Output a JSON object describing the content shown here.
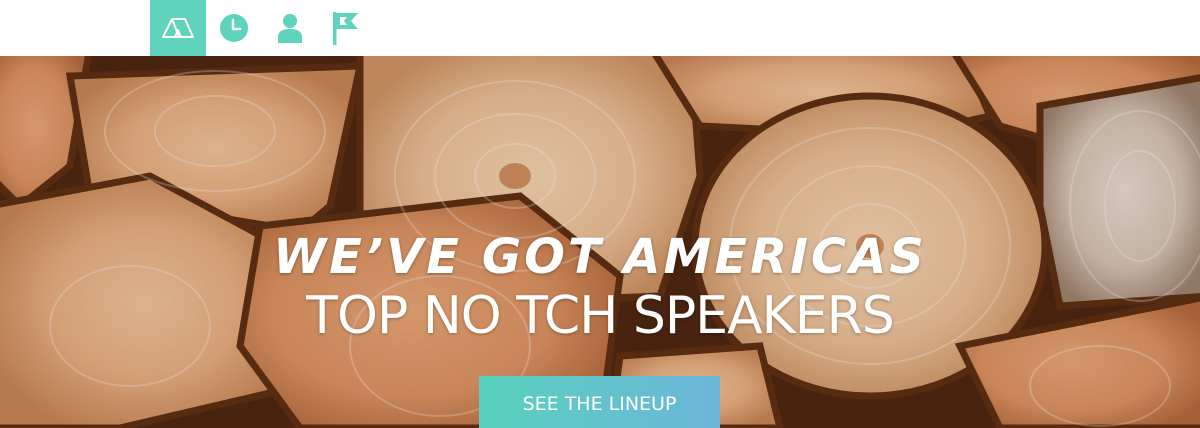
{
  "colors": {
    "accent": "#5fd3bb",
    "cta_start": "#58d1bd",
    "cta_end": "#6cb5d9",
    "hero_text": "#ffffff"
  },
  "nav": {
    "items": [
      {
        "icon": "tent-icon",
        "active": true
      },
      {
        "icon": "clock-icon",
        "active": false
      },
      {
        "icon": "person-icon",
        "active": false
      },
      {
        "icon": "flag-icon",
        "active": false
      }
    ]
  },
  "hero": {
    "headline_line1": "WE’VE GOT AMERICAS",
    "headline_line2": "TOP NO TCH SPEAKERS",
    "cta_label": "SEE THE LINEUP",
    "background": "stacked-firewood-log-ends"
  }
}
